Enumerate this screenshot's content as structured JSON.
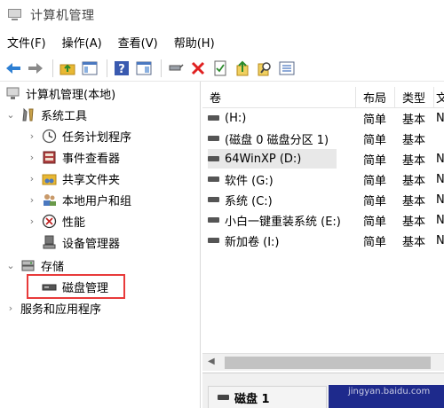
{
  "window": {
    "title": "计算机管理"
  },
  "menu": [
    "文件(F)",
    "操作(A)",
    "查看(V)",
    "帮助(H)"
  ],
  "toolbar": {
    "icons": [
      "back-arrow-icon",
      "forward-arrow-icon",
      "up-folder-icon",
      "console-tree-icon",
      "help-icon",
      "properties-pane-icon",
      "connect-icon",
      "delete-icon",
      "checklist-icon",
      "up-arrow-icon",
      "search-icon",
      "list-icon"
    ],
    "colors": {
      "arrow": "#2d7fd3",
      "delete": "#e02020",
      "folder": "#e8b834"
    }
  },
  "tree": {
    "root": "计算机管理(本地)",
    "items": [
      {
        "label": "系统工具",
        "level": 1,
        "expanded": true,
        "icon": "tools-icon"
      },
      {
        "label": "任务计划程序",
        "level": 2,
        "icon": "clock-icon"
      },
      {
        "label": "事件查看器",
        "level": 2,
        "icon": "event-viewer-icon"
      },
      {
        "label": "共享文件夹",
        "level": 2,
        "icon": "shared-folder-icon"
      },
      {
        "label": "本地用户和组",
        "level": 2,
        "icon": "users-icon"
      },
      {
        "label": "性能",
        "level": 2,
        "icon": "performance-icon"
      },
      {
        "label": "设备管理器",
        "level": 2,
        "icon": "device-manager-icon"
      },
      {
        "label": "存储",
        "level": 1,
        "expanded": true,
        "icon": "storage-icon"
      },
      {
        "label": "磁盘管理",
        "level": 2,
        "icon": "disk-icon",
        "highlighted": true
      },
      {
        "label": "服务和应用程序",
        "level": 1,
        "icon": "services-icon"
      }
    ]
  },
  "volumes": {
    "columns": [
      "卷",
      "布局",
      "类型",
      "文"
    ],
    "rows": [
      {
        "name": "(H:)",
        "layout": "简单",
        "type": "基本",
        "fs": "N"
      },
      {
        "name": "(磁盘 0 磁盘分区 1)",
        "layout": "简单",
        "type": "基本",
        "fs": ""
      },
      {
        "name": "64WinXP  (D:)",
        "layout": "简单",
        "type": "基本",
        "fs": "N",
        "selected": true
      },
      {
        "name": "软件 (G:)",
        "layout": "简单",
        "type": "基本",
        "fs": "N"
      },
      {
        "name": "系统 (C:)",
        "layout": "简单",
        "type": "基本",
        "fs": "N"
      },
      {
        "name": "小白一键重装系统 (E:)",
        "layout": "简单",
        "type": "基本",
        "fs": "N"
      },
      {
        "name": "新加卷 (I:)",
        "layout": "简单",
        "type": "基本",
        "fs": "N"
      }
    ]
  },
  "disk_panel": {
    "label": "磁盘 1"
  },
  "watermark": "jingyan.baidu.com",
  "colors": {
    "highlight_box": "#e83a3a",
    "partition_bar": "#1e2a8c"
  }
}
